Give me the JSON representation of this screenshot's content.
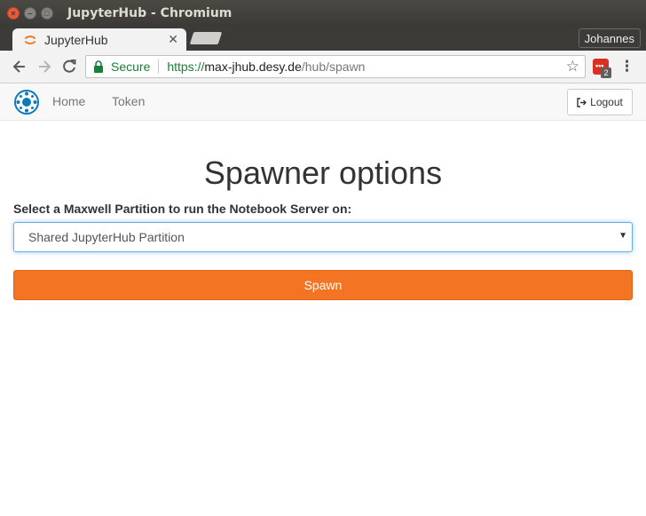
{
  "window": {
    "title": "JupyterHub - Chromium",
    "controls": [
      "close-icon",
      "minimize-icon",
      "maximize-icon"
    ]
  },
  "tabs": [
    {
      "title": "JupyterHub",
      "favicon": "jupyter-logo-icon",
      "close_glyph": "✕"
    }
  ],
  "profile": {
    "name": "Johannes"
  },
  "toolbar": {
    "secure_label": "Secure",
    "url_scheme": "https://",
    "url_host": "max-jhub.desy.de",
    "url_path": "/hub/spawn",
    "extension_badge": "2"
  },
  "hub_nav": {
    "logo": "desy-logo-icon",
    "links": [
      "Home",
      "Token"
    ],
    "logout_label": "Logout"
  },
  "main": {
    "title": "Spawner options",
    "select_label": "Select a Maxwell Partition to run the Notebook Server on:",
    "select_value": "Shared JupyterHub Partition",
    "spawn_label": "Spawn"
  },
  "colors": {
    "accent": "#f37524",
    "focus_border": "#66afe9",
    "secure_green": "#188038",
    "titlebar": "#3c3b37"
  }
}
